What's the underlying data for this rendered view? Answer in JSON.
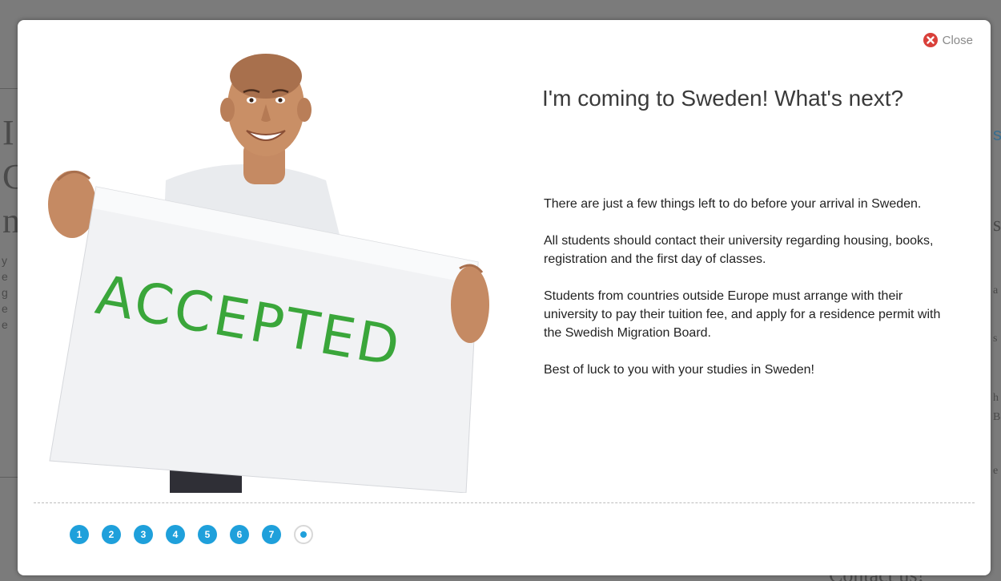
{
  "modal": {
    "close_label": "Close",
    "title": "I'm coming to Sweden! What's next?",
    "paragraphs": [
      "There are just a few things left to do before your arrival in Sweden.",
      "All students should contact their university regarding housing, books, registration and the first day of classes.",
      "Students from countries outside Europe must arrange with their university to pay their tuition fee, and apply for a residence permit with the Swedish Migration Board.",
      "Best of luck to you with your studies in Sweden!"
    ],
    "sign_text": "ACCEPTED",
    "pager": {
      "pages": [
        "1",
        "2",
        "3",
        "4",
        "5",
        "6",
        "7"
      ],
      "active_index": 7
    }
  },
  "background": {
    "footer_text": "Contact us!"
  },
  "colors": {
    "accent": "#1fa0db",
    "sign_text": "#3aa63a",
    "close_icon": "#d9403a"
  }
}
